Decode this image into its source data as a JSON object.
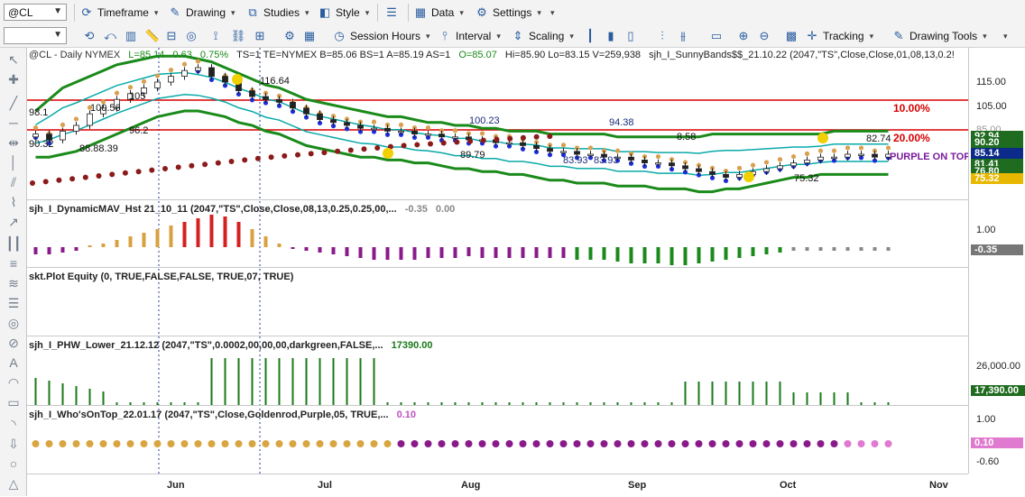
{
  "toolbar1": {
    "symbol": "@CL",
    "timeframe": "Timeframe",
    "drawing": "Drawing",
    "studies": "Studies",
    "style": "Style",
    "data": "Data",
    "settings": "Settings"
  },
  "toolbar2": {
    "session_hours": "Session Hours",
    "interval": "Interval",
    "scaling": "Scaling",
    "tracking": "Tracking",
    "drawing_tools": "Drawing Tools"
  },
  "header": {
    "symbol_line": "@CL - Daily  NYMEX",
    "L": "L=85.14",
    "chg": "0.63",
    "pct": "0.75%",
    "rest": "TS=1  TE=NYMEX  B=85.06  BS=1  A=85.19  AS=1",
    "open": "O=85.07",
    "hilo": "Hi=85.90  Lo=83.15  V=259,938",
    "study": "sjh_I_SunnyBands$$_21.10.22 (2047,\"TS\",Close,Close,01,08,13,0.2!"
  },
  "panels": {
    "p2_label": "sjh_I_DynamicMAV_Hst 21_10_11 (2047,\"TS\",Close,Close,08,13,0.25,0.25,00,...",
    "p2_v1": "-0.35",
    "p2_v2": "0.00",
    "p3_label": "skt.Plot Equity (0, TRUE,FALSE,FALSE, TRUE,07, TRUE)",
    "p4_label": "sjh_I_PHW_Lower_21.12.12 (2047,\"TS\",0.0002,00,00,00,darkgreen,FALSE,...",
    "p4_v": "17390.00",
    "p5_label": "sjh_I_Who'sOnTop_22.01.17 (2047,\"TS\",Close,Goldenrod,Purple,05, TRUE,...",
    "p5_v": "0.10"
  },
  "annotations": {
    "pct10": "10.00%",
    "pct20": "20.00%",
    "purple_on_top": "PURPLE ON TOP",
    "prices": [
      "98.1",
      "105",
      "116.64",
      "100.56",
      "96.2",
      "90.32",
      "88.88.39",
      "100.23",
      "94.38",
      "83.93",
      "83.93",
      "89.79",
      "82.74",
      "75.32",
      "8.58"
    ]
  },
  "axes": {
    "price_ticks": [
      "115.00",
      "105.00",
      "85.00"
    ],
    "price_tags": [
      {
        "v": "92.94",
        "c": "#1f6b1f"
      },
      {
        "v": "90.20",
        "c": "#1f6b1f"
      },
      {
        "v": "85.14",
        "c": "#0b2a8a"
      },
      {
        "v": "81.41",
        "c": "#1f6b1f"
      },
      {
        "v": "76.80",
        "c": "#1f6b1f"
      },
      {
        "v": "75.32",
        "c": "#e8b800"
      }
    ],
    "p2_ticks": [
      "1.00"
    ],
    "p2_tag": "-0.35",
    "p4_ticks": [
      "26,000.00"
    ],
    "p4_tag": "17,390.00",
    "p5_ticks": [
      "1.00",
      "-0.60"
    ],
    "p5_tag": "0.10",
    "months": [
      "Jun",
      "Jul",
      "Aug",
      "Sep",
      "Oct",
      "Nov"
    ]
  },
  "chart_data": {
    "type": "candlestick",
    "title": "@CL - Daily NYMEX",
    "price_range": [
      70,
      120
    ],
    "closes": [
      92,
      90,
      93,
      95,
      99,
      101,
      104,
      106,
      108,
      110,
      112,
      114,
      115,
      112,
      110,
      107,
      105,
      104,
      103,
      101,
      99,
      97,
      96,
      95,
      94,
      94,
      93,
      93,
      92,
      92,
      91,
      91,
      90,
      90,
      89,
      89,
      88,
      87,
      86,
      86,
      85,
      85,
      84,
      84,
      83,
      82,
      82,
      81,
      80,
      79,
      78,
      77,
      78,
      79,
      80,
      81,
      82,
      83,
      84,
      84,
      85,
      85,
      84,
      85
    ],
    "upper_band": [
      100,
      104,
      108,
      110,
      112,
      114,
      116,
      117,
      118,
      119,
      119,
      119,
      118,
      117,
      115,
      113,
      111,
      109,
      108,
      106,
      104,
      103,
      102,
      101,
      100,
      99,
      98,
      98,
      97,
      96,
      96,
      95,
      95,
      94,
      94,
      93,
      93,
      93,
      92,
      92,
      92,
      92,
      92,
      91,
      91,
      91,
      91,
      91,
      91,
      91,
      92,
      92,
      92,
      92,
      92,
      92,
      92,
      92,
      92,
      93,
      93,
      93,
      93,
      93
    ],
    "lower_band": [
      84,
      84,
      85,
      86,
      88,
      90,
      92,
      94,
      96,
      98,
      99,
      100,
      100,
      99,
      98,
      96,
      95,
      93,
      92,
      90,
      88,
      87,
      86,
      85,
      84,
      84,
      83,
      83,
      82,
      82,
      81,
      80,
      80,
      79,
      79,
      78,
      78,
      77,
      76,
      76,
      75,
      75,
      75,
      74,
      74,
      74,
      73,
      73,
      73,
      72,
      72,
      73,
      73,
      74,
      75,
      76,
      77,
      77,
      78,
      78,
      78,
      78,
      78,
      78
    ],
    "sar_series": [
      75,
      75.5,
      76,
      76.5,
      77,
      77.5,
      78,
      78.5,
      79,
      79.5,
      80,
      80.5,
      81,
      81.5,
      82,
      82.5,
      83,
      83.5,
      84,
      84.4,
      84.8,
      85.2,
      85.6,
      86,
      86.4,
      86.8,
      87.2,
      87.6,
      88,
      88.3,
      88.6,
      88.9,
      89.2,
      89.5,
      89.8,
      90.1,
      90.4,
      90.7,
      91,
      91.2
    ],
    "dynamic_mav_hist": [
      -0.2,
      -0.2,
      -0.15,
      -0.1,
      0.05,
      0.1,
      0.2,
      0.3,
      0.4,
      0.5,
      0.6,
      0.7,
      0.8,
      0.9,
      0.85,
      0.7,
      0.5,
      0.3,
      0.1,
      -0.05,
      -0.1,
      -0.15,
      -0.2,
      -0.25,
      -0.3,
      -0.35,
      -0.35,
      -0.35,
      -0.35,
      -0.3,
      -0.3,
      -0.3,
      -0.25,
      -0.3,
      -0.3,
      -0.3,
      -0.3,
      -0.3,
      -0.3,
      -0.3,
      -0.35,
      -0.35,
      -0.35,
      -0.4,
      -0.45,
      -0.45,
      -0.45,
      -0.5,
      -0.5,
      -0.45,
      -0.4,
      -0.35,
      -0.3,
      -0.25,
      -0.2,
      -0.15,
      -0.1,
      -0.1,
      -0.1,
      -0.1,
      -0.1,
      -0.1,
      -0.1,
      -0.1
    ],
    "phw_lower": [
      0.9,
      0.9,
      0.9,
      0.8,
      0.7,
      0.6,
      0.0,
      0.0,
      0.0,
      0.0,
      0.0,
      0.0,
      0.0,
      0.0,
      0.0,
      0.0,
      0.0,
      0.0,
      0.0,
      0.0,
      0.0,
      0.0,
      0.0,
      0.0,
      0.0,
      0.0,
      0.0,
      0.0,
      0.0,
      0.0,
      0.0,
      0.0,
      0.0,
      0.0,
      0.0,
      0.0,
      0.0,
      0.0,
      0.0,
      0.0,
      0.0,
      0.0,
      0.0,
      0.0,
      0.0,
      0.0,
      0.0,
      0.0,
      0.0,
      0.0,
      0.0,
      0.0,
      0.0,
      0.0,
      0.0,
      0.0,
      0.0,
      0.0,
      0.0,
      0.0,
      0.0,
      0.0,
      0.0,
      0.0
    ],
    "whos_on_top": [
      "g",
      "g",
      "g",
      "g",
      "g",
      "g",
      "g",
      "g",
      "g",
      "g",
      "g",
      "g",
      "g",
      "g",
      "g",
      "g",
      "g",
      "g",
      "g",
      "g",
      "g",
      "g",
      "g",
      "g",
      "g",
      "g",
      "g",
      "p",
      "p",
      "p",
      "p",
      "p",
      "p",
      "p",
      "p",
      "p",
      "p",
      "p",
      "p",
      "p",
      "p",
      "p",
      "p",
      "p",
      "p",
      "p",
      "p",
      "p",
      "p",
      "p",
      "p",
      "p",
      "p",
      "p",
      "p",
      "p",
      "p",
      "p",
      "p",
      "p",
      "p",
      "p",
      "p",
      "p"
    ],
    "months": [
      "Jun",
      "Jul",
      "Aug",
      "Sep",
      "Oct",
      "Nov"
    ]
  },
  "colors": {
    "band_outer": "#1a8a1a",
    "band_mid": "#0aa9a9",
    "band_dots_blue": "#1c2fe0",
    "band_dots_orange": "#d8a050",
    "sar": "#8b1a1a",
    "level_red": "#d80000",
    "hist_red": "#d42020",
    "hist_gold": "#d9a040",
    "hist_purple": "#8a1a8a",
    "hist_green": "#1a8a1a",
    "phw": "#1a7a1a",
    "dot_gold": "#d8a540",
    "dot_purple": "#8a1a8a",
    "dot_pink": "#e07ad0"
  }
}
